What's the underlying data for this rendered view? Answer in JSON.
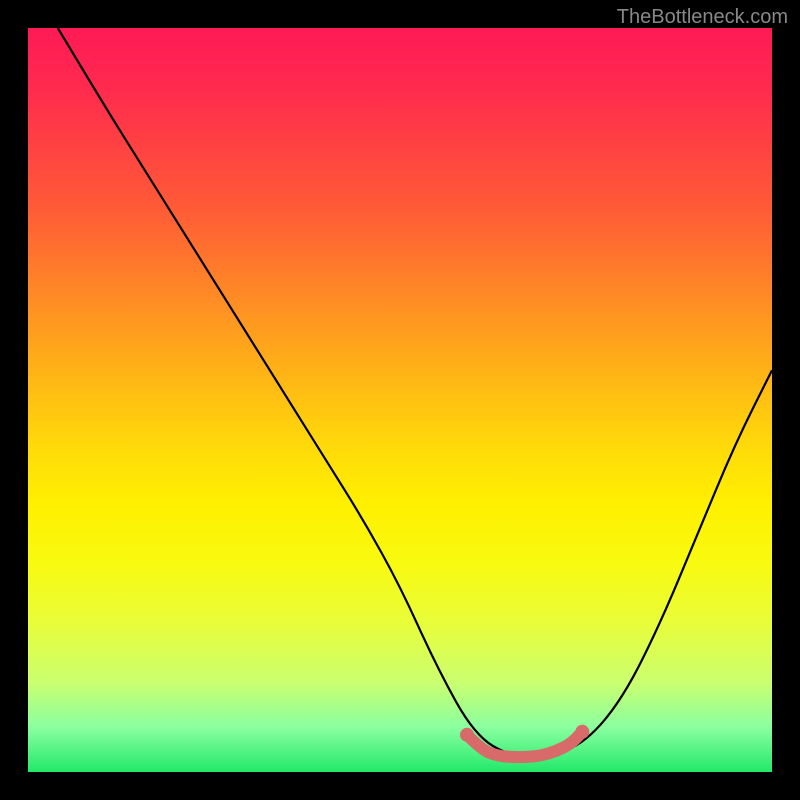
{
  "attribution": "TheBottleneck.com",
  "chart_data": {
    "type": "line",
    "title": "",
    "xlabel": "",
    "ylabel": "",
    "xlim": [
      0,
      100
    ],
    "ylim": [
      0,
      100
    ],
    "series": [
      {
        "name": "bottleneck-curve",
        "color": "#000000",
        "x": [
          4,
          10,
          15,
          20,
          25,
          30,
          35,
          40,
          45,
          50,
          55,
          60,
          65,
          70,
          75,
          80,
          85,
          90,
          95,
          100
        ],
        "y": [
          100,
          90,
          82,
          74,
          66,
          58,
          50,
          42,
          34,
          25,
          14,
          5,
          2,
          2,
          4,
          10,
          20,
          32,
          44,
          54
        ]
      },
      {
        "name": "optimal-range-marker",
        "color": "#d86a6a",
        "x": [
          59,
          61,
          63,
          65,
          67,
          69,
          71,
          73,
          74.5
        ],
        "y": [
          5.0,
          3.0,
          2.2,
          2.0,
          2.0,
          2.2,
          2.8,
          3.8,
          5.4
        ]
      }
    ],
    "background_gradient": {
      "top": "#ff1a55",
      "mid": "#fff000",
      "bottom": "#22e96a"
    }
  },
  "colors": {
    "frame": "#000000",
    "attribution_text": "#888888",
    "curve": "#000000",
    "marker": "#d86a6a"
  }
}
